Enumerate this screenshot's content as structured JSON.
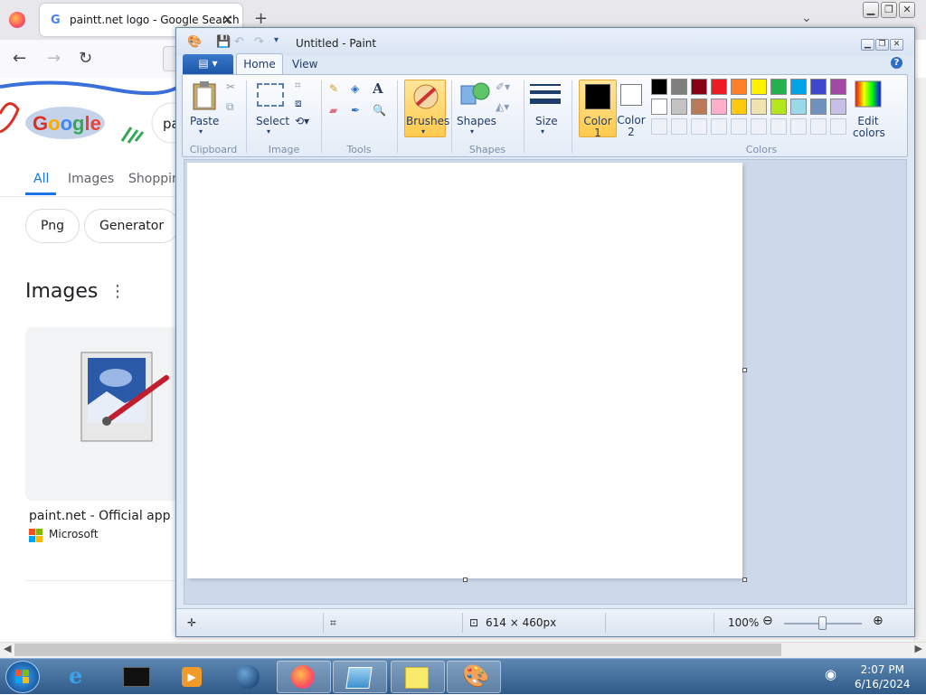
{
  "browser": {
    "tab_title": "paintt.net logo - Google Search",
    "close_glyph": "✕",
    "new_tab_glyph": "+",
    "list_all_tabs_glyph": "⌄",
    "nav": {
      "back": "←",
      "forward": "→",
      "reload": "↻"
    }
  },
  "google": {
    "search_query_partial": "pa",
    "tabs": [
      "All",
      "Images",
      "Shoppin"
    ],
    "chips": [
      "Png",
      "Generator"
    ],
    "images_heading": "Images",
    "result_title": "paint.net - Official app in t",
    "result_source": "Microsoft"
  },
  "paint": {
    "window_title": "Untitled - Paint",
    "tabs": {
      "home": "Home",
      "view": "View"
    },
    "groups": {
      "clipboard": "Clipboard",
      "image": "Image",
      "tools": "Tools",
      "shapes": "Shapes",
      "colors": "Colors"
    },
    "buttons": {
      "paste": "Paste",
      "select": "Select",
      "brushes": "Brushes",
      "shapes": "Shapes",
      "size": "Size",
      "color1": "Color\n1",
      "color1_a": "Color",
      "color1_b": "1",
      "color2_a": "Color",
      "color2_b": "2",
      "edit_colors_a": "Edit",
      "edit_colors_b": "colors"
    },
    "color1": "#000000",
    "color2": "#ffffff",
    "palette_row1": [
      "#000000",
      "#7f7f7f",
      "#880015",
      "#ed1c24",
      "#ff7f27",
      "#fff200",
      "#22b14c",
      "#00a2e8",
      "#3f48cc",
      "#a349a4"
    ],
    "palette_row2": [
      "#ffffff",
      "#c3c3c3",
      "#b97a57",
      "#ffaec9",
      "#ffc90e",
      "#efe4b0",
      "#b5e61d",
      "#99d9ea",
      "#7092be",
      "#c8bfe7"
    ],
    "status": {
      "canvas_size": "614 × 460px",
      "zoom": "100%"
    }
  },
  "taskbar": {
    "time": "2:07 PM",
    "date": "6/16/2024"
  }
}
